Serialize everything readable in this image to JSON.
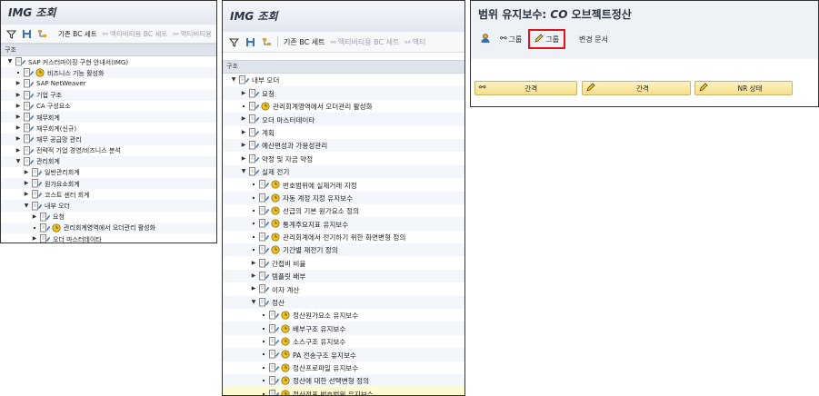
{
  "panel1": {
    "title": "IMG 조회",
    "toolbar": {
      "bc_set": "기존 BC 세트",
      "activity_bc_set": "액티비티용 BC 세트",
      "more": "액티비티용"
    },
    "structure_label": "구조",
    "tree": [
      {
        "level": 0,
        "exp": "open",
        "icon": "doc",
        "label": "SAP 커스터마이징 구현 안내서(IMG)"
      },
      {
        "level": 1,
        "exp": "dot",
        "icon": "doc-clock",
        "label": "비즈니스 기능 활성화"
      },
      {
        "level": 1,
        "exp": "closed",
        "icon": "doc",
        "label": "SAP NetWeaver"
      },
      {
        "level": 1,
        "exp": "closed",
        "icon": "doc",
        "label": "기업 구조"
      },
      {
        "level": 1,
        "exp": "closed",
        "icon": "doc",
        "label": "CA 구성요소"
      },
      {
        "level": 1,
        "exp": "closed",
        "icon": "doc",
        "label": "재무회계"
      },
      {
        "level": 1,
        "exp": "closed",
        "icon": "doc",
        "label": "재무회계(신규)"
      },
      {
        "level": 1,
        "exp": "closed",
        "icon": "doc",
        "label": "재무 공급망 관리"
      },
      {
        "level": 1,
        "exp": "closed",
        "icon": "doc",
        "label": "전략적 기업 경영/비즈니스 분석"
      },
      {
        "level": 1,
        "exp": "open",
        "icon": "doc",
        "label": "관리회계"
      },
      {
        "level": 2,
        "exp": "closed",
        "icon": "doc",
        "label": "일반관리회계"
      },
      {
        "level": 2,
        "exp": "closed",
        "icon": "doc",
        "label": "원가요소회계"
      },
      {
        "level": 2,
        "exp": "closed",
        "icon": "doc",
        "label": "코스트 센터 회계"
      },
      {
        "level": 2,
        "exp": "open",
        "icon": "doc",
        "label": "내부 오더"
      },
      {
        "level": 3,
        "exp": "closed",
        "icon": "doc",
        "label": "요청"
      },
      {
        "level": 3,
        "exp": "dot",
        "icon": "doc-clock",
        "label": "관리회계영역에서 오더관리 활성화"
      },
      {
        "level": 3,
        "exp": "closed",
        "icon": "doc",
        "label": "오더 마스터데이타"
      }
    ]
  },
  "panel2": {
    "title": "IMG 조회",
    "toolbar": {
      "bc_set": "기존 BC 세트",
      "activity_bc_set": "액티비티용 BC 세트",
      "more": "액티"
    },
    "structure_label": "구조",
    "tree": [
      {
        "level": 0,
        "exp": "open",
        "icon": "doc",
        "label": "내부 오더"
      },
      {
        "level": 1,
        "exp": "closed",
        "icon": "doc",
        "label": "요청"
      },
      {
        "level": 1,
        "exp": "dot",
        "icon": "doc-clock",
        "label": "관리회계영역에서 오더관리 활성화"
      },
      {
        "level": 1,
        "exp": "closed",
        "icon": "doc",
        "label": "오더 마스터데이타"
      },
      {
        "level": 1,
        "exp": "closed",
        "icon": "doc",
        "label": "계획"
      },
      {
        "level": 1,
        "exp": "closed",
        "icon": "doc",
        "label": "예산편성과 가용성관리"
      },
      {
        "level": 1,
        "exp": "closed",
        "icon": "doc",
        "label": "약정 및 자금 약정"
      },
      {
        "level": 1,
        "exp": "open",
        "icon": "doc",
        "label": "실제 전기"
      },
      {
        "level": 2,
        "exp": "dot",
        "icon": "doc-clock",
        "label": "번호범위에 실제거래 지정"
      },
      {
        "level": 2,
        "exp": "dot",
        "icon": "doc-clock",
        "label": "자동 계정 지정 유지보수"
      },
      {
        "level": 2,
        "exp": "dot",
        "icon": "doc-clock",
        "label": "선급의 기본 원가요소 정의"
      },
      {
        "level": 2,
        "exp": "dot",
        "icon": "doc-clock",
        "label": "통계주요지표 유지보수"
      },
      {
        "level": 2,
        "exp": "dot",
        "icon": "doc-clock",
        "label": "관리회계에서 전기하기 위한 화면변형 정의"
      },
      {
        "level": 2,
        "exp": "dot",
        "icon": "doc-clock",
        "label": "기간별 재전기 정의"
      },
      {
        "level": 2,
        "exp": "closed",
        "icon": "doc",
        "label": "간접비 비율"
      },
      {
        "level": 2,
        "exp": "closed",
        "icon": "doc",
        "label": "템플릿 배부"
      },
      {
        "level": 2,
        "exp": "closed",
        "icon": "doc",
        "label": "이자 계산"
      },
      {
        "level": 2,
        "exp": "open",
        "icon": "doc",
        "label": "정산"
      },
      {
        "level": 3,
        "exp": "dot",
        "icon": "doc-clock",
        "label": "정산원가요소 유지보수"
      },
      {
        "level": 3,
        "exp": "dot",
        "icon": "doc-clock",
        "label": "배부구조 유지보수"
      },
      {
        "level": 3,
        "exp": "dot",
        "icon": "doc-clock",
        "label": "소스구조 유지보수"
      },
      {
        "level": 3,
        "exp": "dot",
        "icon": "doc-clock",
        "label": "PA 전송구조 유지보수"
      },
      {
        "level": 3,
        "exp": "dot",
        "icon": "doc-clock",
        "label": "정산프로파일 유지보수"
      },
      {
        "level": 3,
        "exp": "dot",
        "icon": "doc-clock",
        "label": "정산에 대한 선택변형 정의"
      },
      {
        "level": 3,
        "exp": "dot",
        "icon": "doc-clock",
        "label": "정산전표 번호범위 유지보수",
        "selected": true
      }
    ]
  },
  "panel3": {
    "title_prefix": "범위 유지보수: ",
    "title_co": "CO",
    "title_suffix": " 오브젝트정산",
    "toolbar": {
      "group_display": "그룹",
      "group_change": "그룹",
      "change_docs": "변경 문서"
    },
    "buttons": {
      "interval_display": "간격",
      "interval_change": "간격",
      "nr_status": "NR 상태"
    }
  },
  "colors": {
    "highlight": "#e0121b",
    "button_fill": "#f6df8a",
    "accent_yellow": "#f2c318"
  }
}
